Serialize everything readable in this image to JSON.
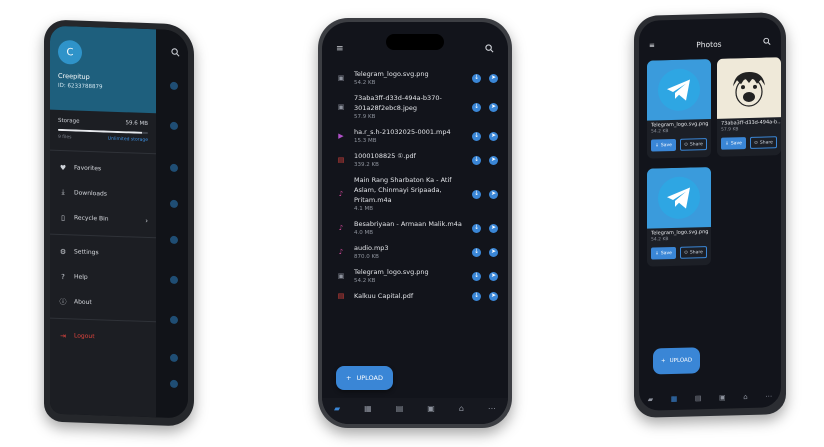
{
  "phone1": {
    "status_time": "",
    "avatar_letter": "C",
    "user_name": "Creepitup",
    "user_id": "ID: 6233788879",
    "storage_label": "Storage",
    "storage_value": "59.6 MB",
    "storage_fraction": 0.93,
    "files_count": "9 files",
    "unlimited_label": "Unlimited storage",
    "menu": [
      {
        "icon": "heart-icon",
        "label": "Favorites"
      },
      {
        "icon": "download-icon",
        "label": "Downloads"
      },
      {
        "icon": "recycle-bin-icon",
        "label": "Recycle Bin"
      },
      {
        "icon": "settings-icon",
        "label": "Settings"
      },
      {
        "icon": "help-icon",
        "label": "Help"
      },
      {
        "icon": "info-icon",
        "label": "About"
      },
      {
        "icon": "logout-icon",
        "label": "Logout"
      }
    ]
  },
  "phone2": {
    "files": [
      {
        "type": "image",
        "name": "Telegram_logo.svg.png",
        "size": "54.2 KB"
      },
      {
        "type": "image",
        "name": "73aba3ff-d33d-494a-b370-301a28f2ebc8.jpeg",
        "size": "57.9 KB"
      },
      {
        "type": "video",
        "name": "ha.r_s.h-21032025-0001.mp4",
        "size": "15.3 MB"
      },
      {
        "type": "pdf",
        "name": "1000108825 ①.pdf",
        "size": "339.2 KB"
      },
      {
        "type": "audio",
        "name": "Main Rang Sharbaton Ka - Atif Aslam, Chinmayi Sripaada, Pritam.m4a",
        "size": "4.1 MB"
      },
      {
        "type": "audio",
        "name": "Besabriyaan - Armaan Malik.m4a",
        "size": "4.0 MB"
      },
      {
        "type": "audio",
        "name": "audio.mp3",
        "size": "870.0 KB"
      },
      {
        "type": "image",
        "name": "Telegram_logo.svg.png",
        "size": "54.2 KB"
      },
      {
        "type": "pdf",
        "name": "Kalkuu Capital.pdf",
        "size": ""
      }
    ],
    "upload_label": "UPLOAD"
  },
  "phone3": {
    "title": "Photos",
    "cards": [
      {
        "name": "Telegram_logo.svg.png",
        "size": "54.2 KB",
        "save": "Save",
        "share": "Share"
      },
      {
        "name": "73aba3ff-d33d-494a-b...",
        "size": "57.9 KB",
        "save": "Save",
        "share": "Share"
      },
      {
        "name": "Telegram_logo.svg.png",
        "size": "54.2 KB",
        "save": "Save",
        "share": "Share"
      }
    ],
    "upload_label": "UPLOAD"
  },
  "colors": {
    "accent": "#3a86d6",
    "drawer_header": "#1e5f7d",
    "background": "#12141b",
    "logout": "#e0443d"
  }
}
